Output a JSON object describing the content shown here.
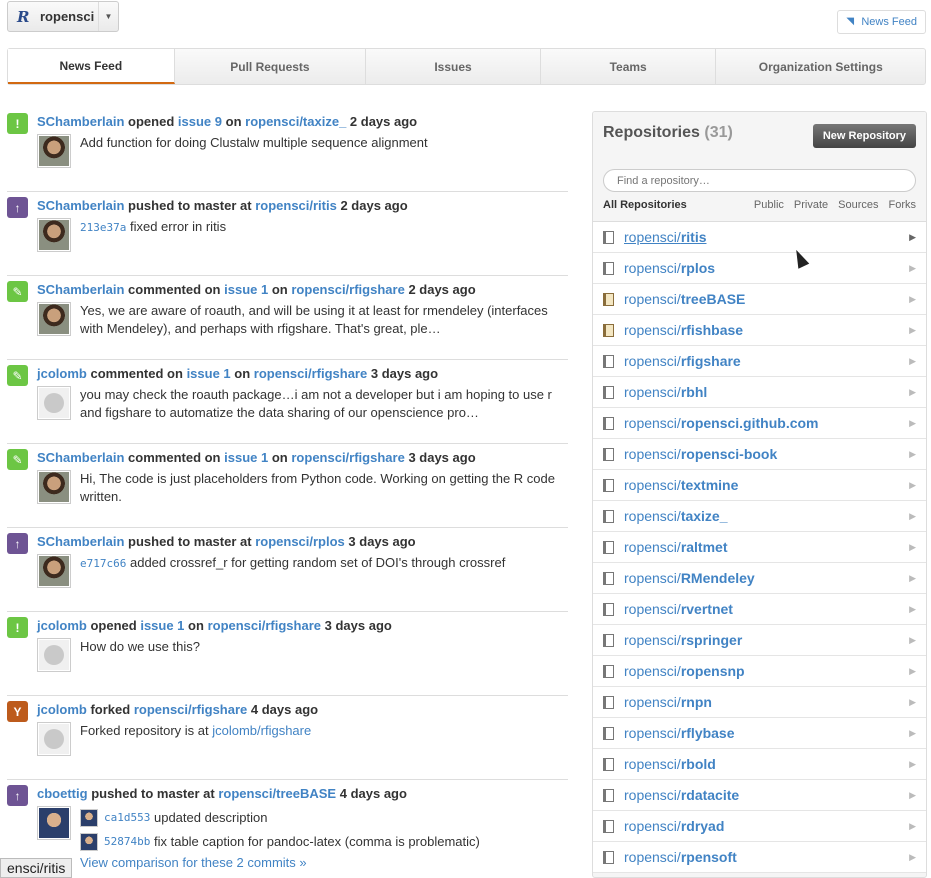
{
  "org": {
    "name": "ropensci",
    "logo": "R"
  },
  "newsfeed_btn": "News Feed",
  "tabs": [
    "News Feed",
    "Pull Requests",
    "Issues",
    "Teams",
    "Organization Settings"
  ],
  "feed": [
    {
      "icon": "issue-opened-icon",
      "actor": "SChamberlain",
      "action": "opened",
      "target": "issue 9",
      "prep": "on",
      "repo": "ropensci/taxize_",
      "time": "2 days ago",
      "avatar": "person",
      "message": "Add function for doing Clustalw multiple sequence alignment"
    },
    {
      "icon": "push-icon",
      "actor": "SChamberlain",
      "action": "pushed to master at",
      "repo": "ropensci/ritis",
      "time": "2 days ago",
      "avatar": "person",
      "sha": "213e37a",
      "message": "fixed error in ritis"
    },
    {
      "icon": "comment-icon",
      "actor": "SChamberlain",
      "action": "commented on",
      "target": "issue 1",
      "prep": "on",
      "repo": "ropensci/rfigshare",
      "time": "2 days ago",
      "avatar": "person",
      "message": "Yes, we are aware of roauth, and will be using it at least for rmendeley (interfaces with Mendeley), and perhaps with rfigshare. That's great, ple…"
    },
    {
      "icon": "comment-icon",
      "actor": "jcolomb",
      "action": "commented on",
      "target": "issue 1",
      "prep": "on",
      "repo": "ropensci/rfigshare",
      "time": "3 days ago",
      "avatar": "github",
      "message": "you may check the roauth package…i am not a developer but i am hoping to use r and figshare to automatize the data sharing of our openscience pro…"
    },
    {
      "icon": "comment-icon",
      "actor": "SChamberlain",
      "action": "commented on",
      "target": "issue 1",
      "prep": "on",
      "repo": "ropensci/rfigshare",
      "time": "3 days ago",
      "avatar": "person",
      "message": "Hi, The code is just placeholders from Python code. Working on getting the R code written."
    },
    {
      "icon": "push-icon",
      "actor": "SChamberlain",
      "action": "pushed to master at",
      "repo": "ropensci/rplos",
      "time": "3 days ago",
      "avatar": "person",
      "sha": "e717c66",
      "message": "added crossref_r for getting random set of DOI's through crossref"
    },
    {
      "icon": "issue-opened-icon",
      "actor": "jcolomb",
      "action": "opened",
      "target": "issue 1",
      "prep": "on",
      "repo": "ropensci/rfigshare",
      "time": "3 days ago",
      "avatar": "github",
      "message": "How do we use this?"
    },
    {
      "icon": "fork-icon",
      "actor": "jcolomb",
      "action": "forked",
      "repo": "ropensci/rfigshare",
      "time": "4 days ago",
      "avatar": "github",
      "message": "Forked repository is at",
      "link": "jcolomb/rfigshare"
    },
    {
      "icon": "push-icon",
      "actor": "cboettig",
      "action": "pushed to master at",
      "repo": "ropensci/treeBASE",
      "time": "4 days ago",
      "avatar": "carl",
      "commits": [
        {
          "sha": "ca1d553",
          "message": "updated description"
        },
        {
          "sha": "52874bb",
          "message": "fix table caption for pandoc-latex (comma is problematic)"
        }
      ],
      "compare": "View comparison for these 2 commits »"
    }
  ],
  "repos": {
    "title": "Repositories",
    "count": "(31)",
    "new_button": "New Repository",
    "filter_placeholder": "Find a repository…",
    "filters": [
      "All Repositories",
      "Public",
      "Private",
      "Sources",
      "Forks"
    ],
    "items": [
      {
        "owner": "ropensci/",
        "name": "ritis",
        "fork": false
      },
      {
        "owner": "ropensci/",
        "name": "rplos",
        "fork": false
      },
      {
        "owner": "ropensci/",
        "name": "treeBASE",
        "fork": true
      },
      {
        "owner": "ropensci/",
        "name": "rfishbase",
        "fork": true
      },
      {
        "owner": "ropensci/",
        "name": "rfigshare",
        "fork": false
      },
      {
        "owner": "ropensci/",
        "name": "rbhl",
        "fork": false
      },
      {
        "owner": "ropensci/",
        "name": "ropensci.github.com",
        "fork": false
      },
      {
        "owner": "ropensci/",
        "name": "ropensci-book",
        "fork": false
      },
      {
        "owner": "ropensci/",
        "name": "textmine",
        "fork": false
      },
      {
        "owner": "ropensci/",
        "name": "taxize_",
        "fork": false
      },
      {
        "owner": "ropensci/",
        "name": "raltmet",
        "fork": false
      },
      {
        "owner": "ropensci/",
        "name": "RMendeley",
        "fork": false
      },
      {
        "owner": "ropensci/",
        "name": "rvertnet",
        "fork": false
      },
      {
        "owner": "ropensci/",
        "name": "rspringer",
        "fork": false
      },
      {
        "owner": "ropensci/",
        "name": "ropensnp",
        "fork": false
      },
      {
        "owner": "ropensci/",
        "name": "rnpn",
        "fork": false
      },
      {
        "owner": "ropensci/",
        "name": "rflybase",
        "fork": false
      },
      {
        "owner": "ropensci/",
        "name": "rbold",
        "fork": false
      },
      {
        "owner": "ropensci/",
        "name": "rdatacite",
        "fork": false
      },
      {
        "owner": "ropensci/",
        "name": "rdryad",
        "fork": false
      },
      {
        "owner": "ropensci/",
        "name": "rpensoft",
        "fork": false
      }
    ]
  },
  "status_tip": "ensci/ritis"
}
